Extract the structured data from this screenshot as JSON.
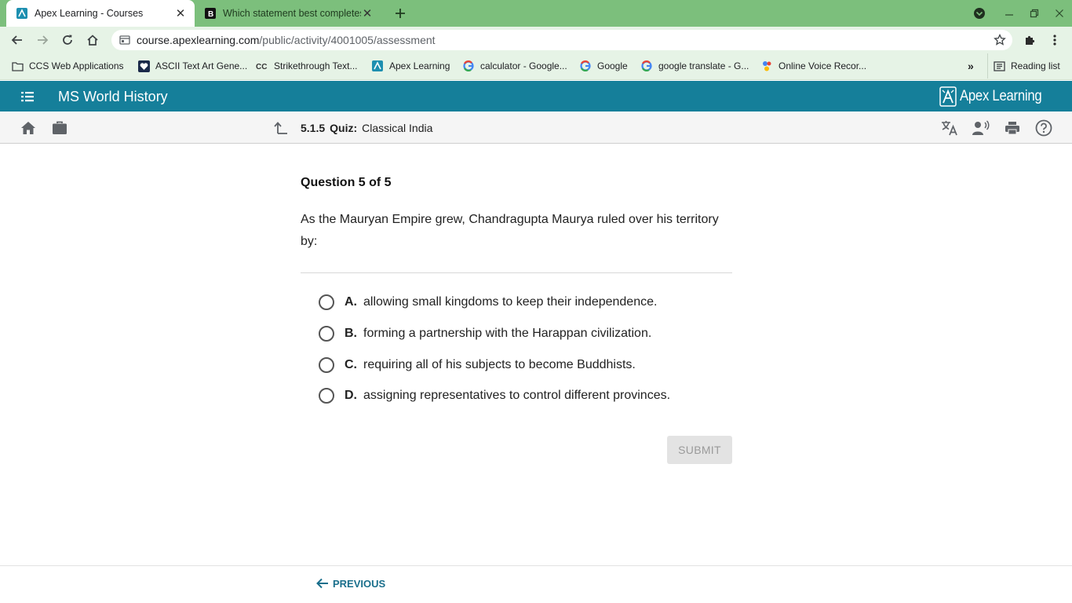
{
  "browser": {
    "tabs": [
      {
        "title": "Apex Learning - Courses",
        "favicon": "apex-icon",
        "active": true
      },
      {
        "title": "Which statement best completes",
        "favicon": "brainly-icon",
        "active": false
      }
    ],
    "url_host": "course.apexlearning.com",
    "url_path": "/public/activity/4001005/assessment",
    "bookmarks": [
      {
        "label": "CCS Web Applications",
        "icon": "folder-icon"
      },
      {
        "label": "ASCII Text Art Gene...",
        "icon": "heart-icon"
      },
      {
        "label": "Strikethrough Text...",
        "icon": "cc-icon"
      },
      {
        "label": "Apex Learning",
        "icon": "apex-icon"
      },
      {
        "label": "calculator - Google...",
        "icon": "google-icon"
      },
      {
        "label": "Google",
        "icon": "google-icon"
      },
      {
        "label": "google translate - G...",
        "icon": "google-icon"
      },
      {
        "label": "Online Voice Recor...",
        "icon": "voice-recorder-icon"
      }
    ],
    "overflow_label": "»",
    "reading_list": "Reading list"
  },
  "app": {
    "course_title": "MS World History",
    "brand": "Apex Learning",
    "lesson_number": "5.1.5",
    "activity_type": "Quiz:",
    "activity_title": "Classical India"
  },
  "question": {
    "counter": "Question 5 of 5",
    "prompt": "As the Mauryan Empire grew, Chandragupta Maurya ruled over his territory by:",
    "options": [
      {
        "letter": "A.",
        "text": "allowing small kingdoms to keep their independence."
      },
      {
        "letter": "B.",
        "text": "forming a partnership with the Harappan civilization."
      },
      {
        "letter": "C.",
        "text": "requiring all of his subjects to become Buddhists."
      },
      {
        "letter": "D.",
        "text": "assigning representatives to control different provinces."
      }
    ],
    "submit_label": "SUBMIT"
  },
  "footer": {
    "previous_label": "PREVIOUS"
  },
  "colors": {
    "chrome_green": "#7cbf7c",
    "app_teal": "#157f9a",
    "link_blue": "#1a6f8c"
  }
}
